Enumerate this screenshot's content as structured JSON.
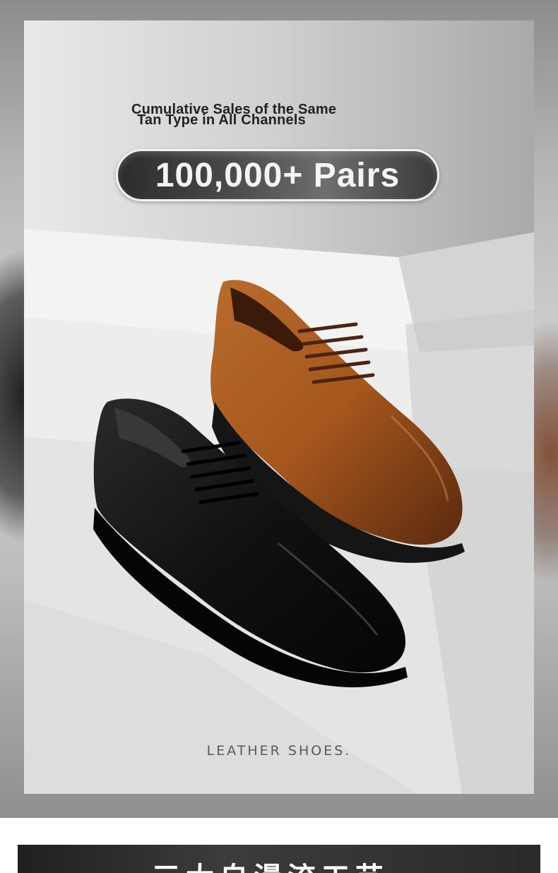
{
  "headline": {
    "line1": "Cumulative Sales of the Same",
    "line2": "Tan Type in All Channels"
  },
  "sales_badge": "100,000+ Pairs",
  "caption": "LEATHER SHOES.",
  "next_section_title": "三大自漫流工艺",
  "colors": {
    "tan_leather": "#a0561f",
    "black_leather": "#141414",
    "pill_dark": "#2b2b2b",
    "stair_white": "#f1f1f1"
  }
}
